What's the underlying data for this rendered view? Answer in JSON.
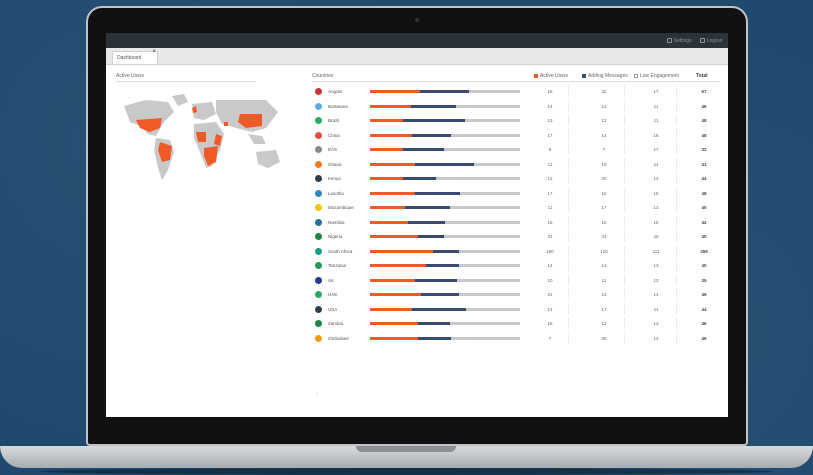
{
  "app": {
    "topbar": {
      "item1": "Settings",
      "item2": "Logout"
    },
    "tab": {
      "label": "Dashboard"
    }
  },
  "left": {
    "title": "Active Users"
  },
  "right": {
    "title": "Countries",
    "legend": [
      {
        "label": "Active Users",
        "color": "#f05a28"
      },
      {
        "label": "Adding Messages",
        "color": "#3b4a73"
      },
      {
        "label": "Low Engagement",
        "color": "#c6cacd"
      }
    ],
    "total_header": "Total",
    "rows": [
      {
        "name": "Angola",
        "flag": "#c0392b",
        "orange": 0.33,
        "blue": 0.33,
        "c1": "18",
        "c2": "32",
        "c3": "17",
        "total": "67"
      },
      {
        "name": "Botswana",
        "flag": "#5dade2",
        "orange": 0.27,
        "blue": 0.3,
        "c1": "14",
        "c2": "21",
        "c3": "11",
        "total": "46"
      },
      {
        "name": "Brazil",
        "flag": "#27ae60",
        "orange": 0.22,
        "blue": 0.41,
        "c1": "13",
        "c2": "13",
        "c3": "11",
        "total": "48"
      },
      {
        "name": "China",
        "flag": "#e74c3c",
        "orange": 0.28,
        "blue": 0.26,
        "c1": "17",
        "c2": "14",
        "c3": "18",
        "total": "48"
      },
      {
        "name": "EAS",
        "flag": "#7f8c8d",
        "orange": 0.22,
        "blue": 0.27,
        "c1": "8",
        "c2": "7",
        "c3": "17",
        "total": "32"
      },
      {
        "name": "Ghana",
        "flag": "#e67e22",
        "orange": 0.3,
        "blue": 0.39,
        "c1": "11",
        "c2": "19",
        "c3": "11",
        "total": "41"
      },
      {
        "name": "Kenya",
        "flag": "#2c3e50",
        "orange": 0.22,
        "blue": 0.22,
        "c1": "12",
        "c2": "20",
        "c3": "14",
        "total": "44"
      },
      {
        "name": "Lesotho",
        "flag": "#2e86c1",
        "orange": 0.3,
        "blue": 0.3,
        "c1": "17",
        "c2": "15",
        "c3": "16",
        "total": "48"
      },
      {
        "name": "Mozambique",
        "flag": "#f1c40f",
        "orange": 0.23,
        "blue": 0.3,
        "c1": "11",
        "c2": "17",
        "c3": "13",
        "total": "40"
      },
      {
        "name": "Namibia",
        "flag": "#2471a3",
        "orange": 0.25,
        "blue": 0.25,
        "c1": "15",
        "c2": "15",
        "c3": "15",
        "total": "42"
      },
      {
        "name": "Nigeria",
        "flag": "#1e8449",
        "orange": 0.32,
        "blue": 0.17,
        "c1": "41",
        "c2": "41",
        "c3": "20",
        "total": "40"
      },
      {
        "name": "South Africa",
        "flag": "#16a085",
        "orange": 0.42,
        "blue": 0.17,
        "c1": "190",
        "c2": "120",
        "c3": "111",
        "total": "359"
      },
      {
        "name": "Tanzania",
        "flag": "#229954",
        "orange": 0.37,
        "blue": 0.22,
        "c1": "14",
        "c2": "13",
        "c3": "13",
        "total": "40"
      },
      {
        "name": "UK",
        "flag": "#1f3a93",
        "orange": 0.3,
        "blue": 0.28,
        "c1": "10",
        "c2": "11",
        "c3": "13",
        "total": "35"
      },
      {
        "name": "UAE",
        "flag": "#27ae60",
        "orange": 0.34,
        "blue": 0.25,
        "c1": "21",
        "c2": "13",
        "c3": "14",
        "total": "49"
      },
      {
        "name": "USA",
        "flag": "#2e4053",
        "orange": 0.28,
        "blue": 0.36,
        "c1": "14",
        "c2": "17",
        "c3": "11",
        "total": "44"
      },
      {
        "name": "Zambia",
        "flag": "#1d8348",
        "orange": 0.32,
        "blue": 0.21,
        "c1": "18",
        "c2": "12",
        "c3": "13",
        "total": "46"
      },
      {
        "name": "Zimbabwe",
        "flag": "#f39c12",
        "orange": 0.32,
        "blue": 0.22,
        "c1": "7",
        "c2": "30",
        "c3": "14",
        "total": "49"
      }
    ]
  }
}
